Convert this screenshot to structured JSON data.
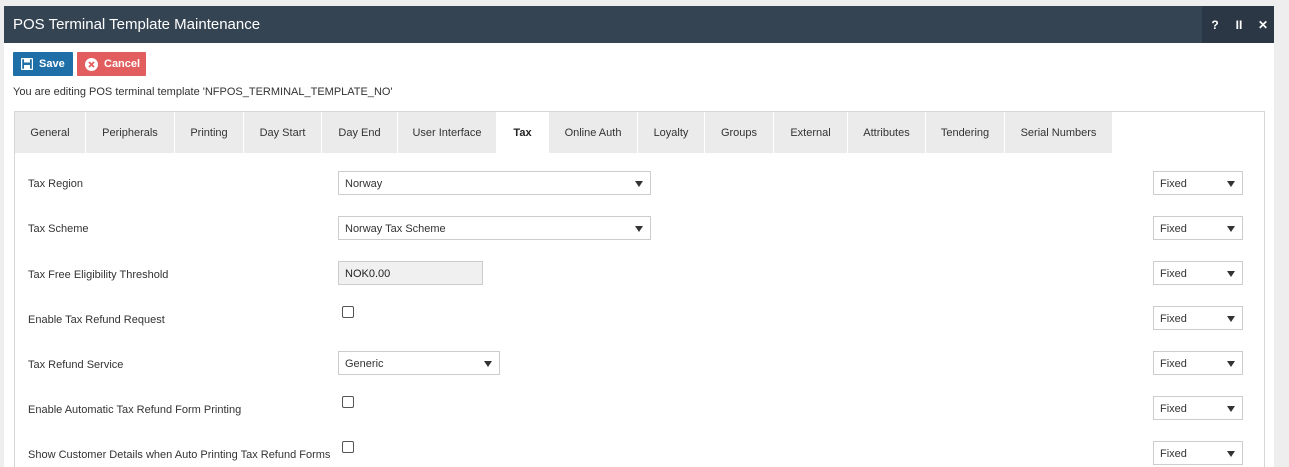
{
  "window": {
    "title": "POS Terminal Template Maintenance",
    "controls": {
      "help": "?",
      "pause": "II",
      "close": "✕"
    }
  },
  "toolbar": {
    "save_label": "Save",
    "cancel_label": "Cancel"
  },
  "notice": "You are editing POS terminal template 'NFPOS_TERMINAL_TEMPLATE_NO'",
  "tabs": [
    {
      "label": "General"
    },
    {
      "label": "Peripherals"
    },
    {
      "label": "Printing"
    },
    {
      "label": "Day Start"
    },
    {
      "label": "Day End"
    },
    {
      "label": "User Interface"
    },
    {
      "label": "Tax",
      "active": true
    },
    {
      "label": "Online Auth"
    },
    {
      "label": "Loyalty"
    },
    {
      "label": "Groups"
    },
    {
      "label": "External"
    },
    {
      "label": "Attributes"
    },
    {
      "label": "Tendering"
    },
    {
      "label": "Serial Numbers"
    }
  ],
  "form": {
    "tax_region": {
      "label": "Tax Region",
      "value": "Norway",
      "mode": "Fixed"
    },
    "tax_scheme": {
      "label": "Tax Scheme",
      "value": "Norway Tax Scheme",
      "mode": "Fixed"
    },
    "tax_free_threshold": {
      "label": "Tax Free Eligibility Threshold",
      "value": "NOK0.00",
      "mode": "Fixed"
    },
    "enable_tax_refund_request": {
      "label": "Enable Tax Refund Request",
      "checked": false,
      "mode": "Fixed"
    },
    "tax_refund_service": {
      "label": "Tax Refund Service",
      "value": "Generic",
      "mode": "Fixed"
    },
    "enable_auto_refund_printing": {
      "label": "Enable Automatic Tax Refund Form Printing",
      "checked": false,
      "mode": "Fixed"
    },
    "show_customer_details": {
      "label": "Show Customer Details when Auto Printing Tax Refund Forms",
      "checked": false,
      "mode": "Fixed"
    }
  },
  "colors": {
    "titlebar": "#354453",
    "save_button": "#1e6fa8",
    "cancel_button": "#e25d5d"
  }
}
